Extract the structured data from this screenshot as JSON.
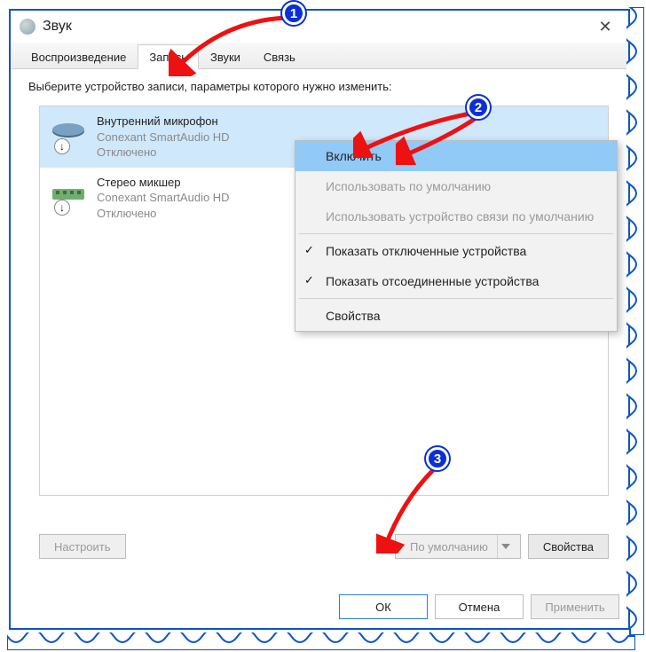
{
  "window": {
    "title": "Звук",
    "close_label": "✕"
  },
  "tabs": {
    "playback": "Воспроизведение",
    "recording": "Запись",
    "sounds": "Звуки",
    "communications": "Связь"
  },
  "instruction": "Выберите устройство записи, параметры которого нужно изменить:",
  "devices": [
    {
      "name": "Внутренний микрофон",
      "driver": "Conexant SmartAudio HD",
      "status": "Отключено"
    },
    {
      "name": "Стерео микшер",
      "driver": "Conexant SmartAudio HD",
      "status": "Отключено"
    }
  ],
  "context_menu": {
    "enable": "Включить",
    "set_default": "Использовать по умолчанию",
    "set_default_comm": "Использовать устройство связи по умолчанию",
    "show_disabled": "Показать отключенные устройства",
    "show_disconnected": "Показать отсоединенные устройства",
    "properties": "Свойства"
  },
  "bottom": {
    "configure": "Настроить",
    "set_default_btn": "По умолчанию",
    "properties_btn": "Свойства"
  },
  "dialog_buttons": {
    "ok": "ОК",
    "cancel": "Отмена",
    "apply": "Применить"
  },
  "markers": {
    "m1": "1",
    "m2": "2",
    "m3": "3"
  }
}
